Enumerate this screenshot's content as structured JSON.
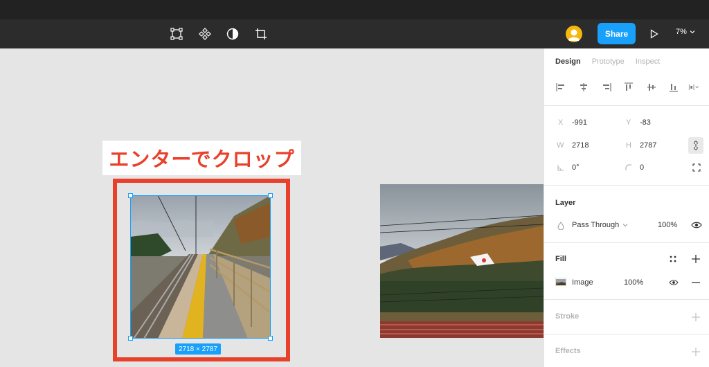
{
  "toolbar": {
    "tools": [
      "frame-icon",
      "component-icon",
      "contrast-icon",
      "crop-icon"
    ],
    "share_label": "Share",
    "zoom": "7%"
  },
  "canvas": {
    "caption": "エンターでクロップ",
    "dimensions": "2718 × 2787"
  },
  "panel": {
    "tabs": [
      {
        "label": "Design",
        "active": true
      },
      {
        "label": "Prototype",
        "active": false
      },
      {
        "label": "Inspect",
        "active": false
      }
    ],
    "x_label": "X",
    "x_value": "-991",
    "y_label": "Y",
    "y_value": "-83",
    "w_label": "W",
    "w_value": "2718",
    "h_label": "H",
    "h_value": "2787",
    "rotation": "0°",
    "radius": "0",
    "layer": {
      "title": "Layer",
      "blend_mode": "Pass Through",
      "opacity": "100%"
    },
    "fill": {
      "title": "Fill",
      "type": "Image",
      "opacity": "100%"
    },
    "stroke_title": "Stroke",
    "effects_title": "Effects"
  },
  "colors": {
    "accent": "#18a0fb",
    "caption_red": "#e8402a",
    "toolbar": "#2c2c2c"
  }
}
